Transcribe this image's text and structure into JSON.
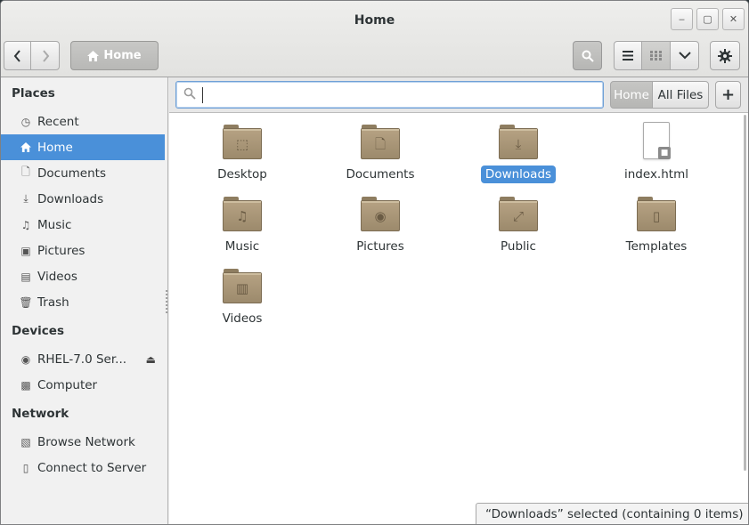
{
  "window": {
    "title": "Home",
    "controls": {
      "minimize": "minimize-icon",
      "maximize": "maximize-icon",
      "close": "close-icon"
    }
  },
  "toolbar": {
    "back_icon": "chevron-left-icon",
    "forward_icon": "chevron-right-icon",
    "path_button_label": "Home",
    "search_icon": "search-icon",
    "list_view_icon": "list-view-icon",
    "grid_view_icon": "grid-view-icon",
    "view_menu_icon": "chevron-down-icon",
    "settings_icon": "gear-icon"
  },
  "sidebar": {
    "places_title": "Places",
    "places": [
      {
        "label": "Recent",
        "icon": "clock-icon"
      },
      {
        "label": "Home",
        "icon": "home-icon",
        "active": true
      },
      {
        "label": "Documents",
        "icon": "document-icon"
      },
      {
        "label": "Downloads",
        "icon": "download-icon"
      },
      {
        "label": "Music",
        "icon": "music-icon"
      },
      {
        "label": "Pictures",
        "icon": "camera-icon"
      },
      {
        "label": "Videos",
        "icon": "video-icon"
      },
      {
        "label": "Trash",
        "icon": "trash-icon"
      }
    ],
    "devices_title": "Devices",
    "devices": [
      {
        "label": "RHEL-7.0 Ser...",
        "icon": "disc-icon",
        "eject": "eject-icon"
      },
      {
        "label": "Computer",
        "icon": "drive-icon"
      }
    ],
    "network_title": "Network",
    "network": [
      {
        "label": "Browse Network",
        "icon": "network-icon"
      },
      {
        "label": "Connect to Server",
        "icon": "server-icon"
      }
    ]
  },
  "search": {
    "value": "",
    "placeholder": "",
    "scope_home": "Home",
    "scope_all": "All Files",
    "add_label": "+"
  },
  "files": [
    {
      "name": "Desktop",
      "type": "folder",
      "emblem": "desktop-icon"
    },
    {
      "name": "Documents",
      "type": "folder",
      "emblem": "document-icon"
    },
    {
      "name": "Downloads",
      "type": "folder",
      "emblem": "download-icon",
      "selected": true
    },
    {
      "name": "index.html",
      "type": "file",
      "emblem": "lock-icon"
    },
    {
      "name": "Music",
      "type": "folder",
      "emblem": "music-icon"
    },
    {
      "name": "Pictures",
      "type": "folder",
      "emblem": "camera-icon"
    },
    {
      "name": "Public",
      "type": "folder",
      "emblem": "share-icon"
    },
    {
      "name": "Templates",
      "type": "folder",
      "emblem": "template-icon"
    },
    {
      "name": "Videos",
      "type": "folder",
      "emblem": "film-icon"
    }
  ],
  "status": {
    "text": "“Downloads” selected  (containing 0 items)"
  },
  "colors": {
    "accent": "#4a90d9",
    "folder": "#a8967a"
  }
}
